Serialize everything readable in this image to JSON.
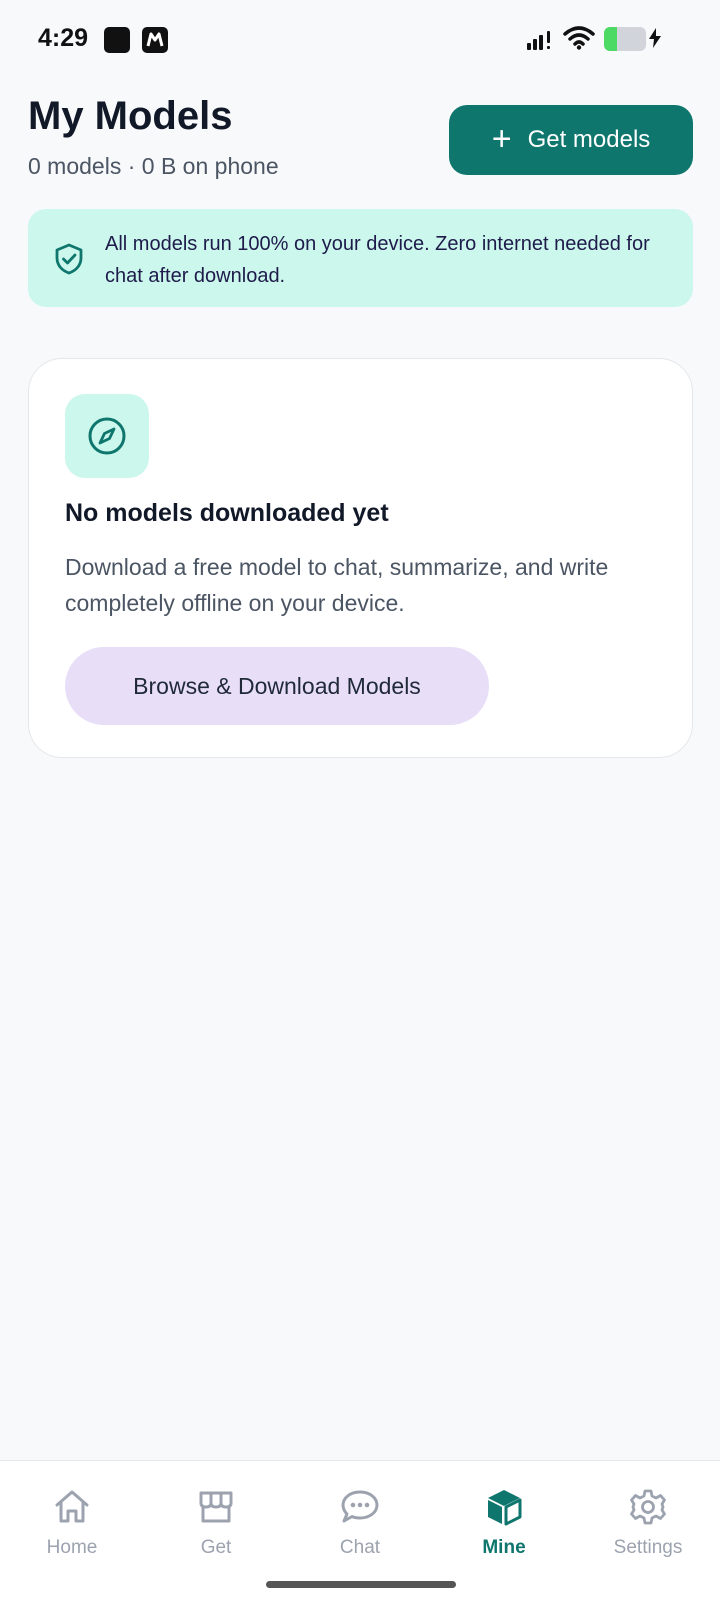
{
  "status_bar": {
    "time": "4:29",
    "battery_level": 0.3,
    "battery_color": "#4cd964"
  },
  "header": {
    "title": "My Models",
    "subtitle": "0 models · 0 B on phone",
    "get_models_label": "Get models",
    "get_models_icon": "plus-icon"
  },
  "info_banner": {
    "icon": "shield-check-icon",
    "text": "All models run 100% on your device. Zero internet needed for chat after download."
  },
  "empty_state": {
    "icon": "compass-icon",
    "title": "No models downloaded yet",
    "description": "Download a free model to chat, summarize, and write completely offline on your device.",
    "button_label": "Browse & Download Models"
  },
  "bottom_nav": {
    "items": [
      {
        "label": "Home",
        "icon": "home-icon",
        "active": false
      },
      {
        "label": "Get",
        "icon": "store-icon",
        "active": false
      },
      {
        "label": "Chat",
        "icon": "chat-bubble-icon",
        "active": false
      },
      {
        "label": "Mine",
        "icon": "cube-icon",
        "active": true
      },
      {
        "label": "Settings",
        "icon": "gear-icon",
        "active": false
      }
    ]
  },
  "colors": {
    "accent": "#0f766e",
    "banner_bg": "#ccf7ec",
    "browse_button_bg": "#e8def8",
    "background": "#f8f9fb"
  }
}
